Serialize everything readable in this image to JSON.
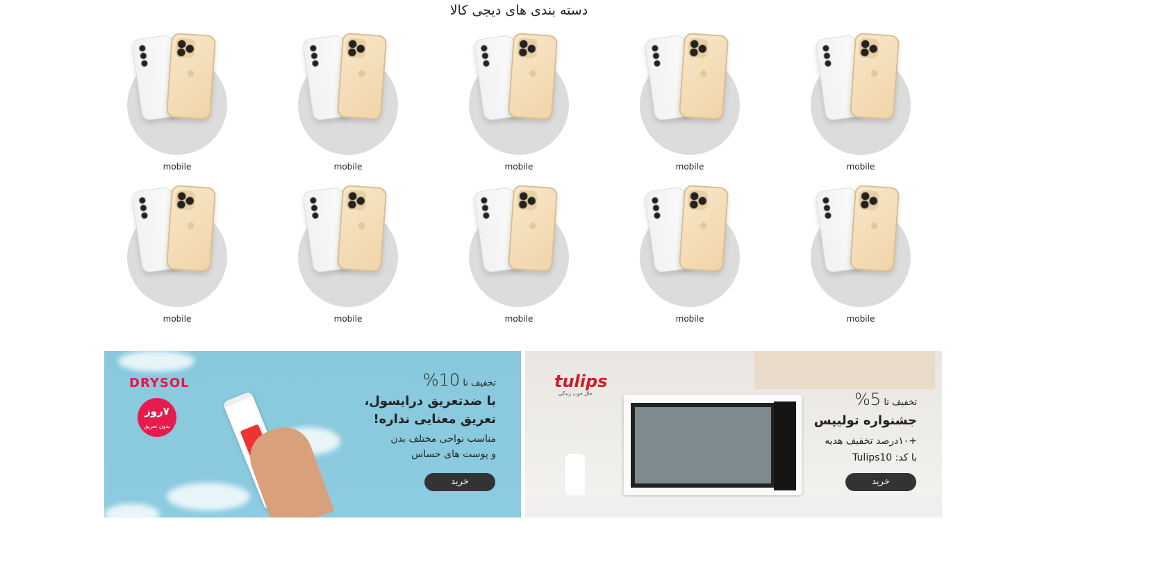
{
  "section_title": "دسته بندی های دیجی کالا",
  "categories": [
    {
      "label": "mobile"
    },
    {
      "label": "mobile"
    },
    {
      "label": "mobile"
    },
    {
      "label": "mobile"
    },
    {
      "label": "mobile"
    },
    {
      "label": "mobile"
    },
    {
      "label": "mobile"
    },
    {
      "label": "mobile"
    },
    {
      "label": "mobile"
    },
    {
      "label": "mobile"
    }
  ],
  "banners": [
    {
      "brand": "DRYSOL",
      "badge_main": "۷روز",
      "badge_sub": "بدون تعریق",
      "discount_prefix": "تخفیف تا",
      "discount_value": "10%",
      "headline_1": "با ضدتعریق درایسول،",
      "headline_2": "تعریق معنایی نداره!",
      "sub_1": "مناسب نواحی مختلف بدن",
      "sub_2": "و پوست های حساس",
      "button": "خرید"
    },
    {
      "brand": "tulips",
      "brand_tagline": "حال خوب زندگی",
      "discount_prefix": "تخفیف تا",
      "discount_value": "5%",
      "headline_1": "جشنواره تولیپس",
      "sub_1": "+۱۰درصد تخفیف هدیه",
      "sub_2": "با کد: Tulips10",
      "button": "خرید"
    }
  ]
}
